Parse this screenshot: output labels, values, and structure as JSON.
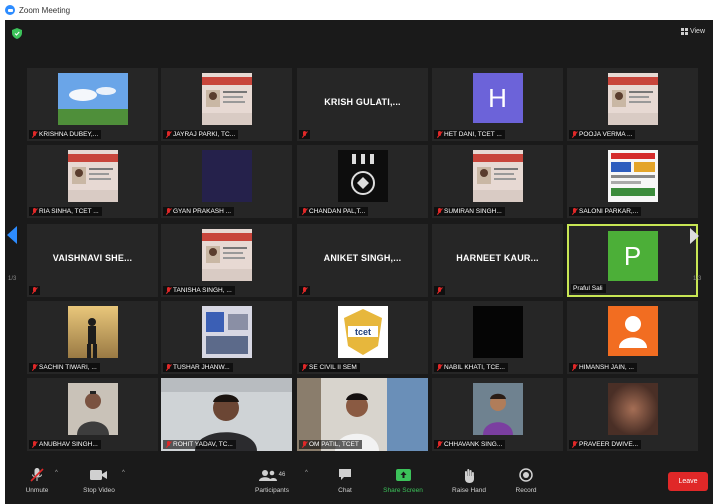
{
  "window": {
    "title": "Zoom Meeting"
  },
  "topbar": {
    "view_label": "View"
  },
  "page_indicator": {
    "left": "1/3",
    "right": "1/3"
  },
  "participants": [
    {
      "name": "KRISHNA DUBEY,...",
      "muted": true,
      "kind": "photo",
      "photo": "sky"
    },
    {
      "name": "JAYRAJ PARKI, TC...",
      "muted": true,
      "kind": "photo",
      "photo": "idcard"
    },
    {
      "name": "",
      "display_text": "KRISH GULATI,...",
      "muted": true,
      "kind": "text"
    },
    {
      "name": "HET DANI, TCET ...",
      "muted": true,
      "kind": "avatar",
      "initial": "H",
      "color": "#6c63d9"
    },
    {
      "name": "POOJA VERMA ...",
      "muted": true,
      "kind": "photo",
      "photo": "idcard"
    },
    {
      "name": "RIA SINHA, TCET ...",
      "muted": true,
      "kind": "photo",
      "photo": "idcard"
    },
    {
      "name": "GYAN PRAKASH ...",
      "muted": true,
      "kind": "photo",
      "photo": "dark"
    },
    {
      "name": "CHANDAN PAL,T...",
      "muted": true,
      "kind": "photo",
      "photo": "crest"
    },
    {
      "name": "SUMIRAN SINGH...",
      "muted": true,
      "kind": "photo",
      "photo": "idcard"
    },
    {
      "name": "SALONI PARKAR,...",
      "muted": true,
      "kind": "photo",
      "photo": "certificate"
    },
    {
      "name": "",
      "display_text": "VAISHNAVI SHE...",
      "muted": true,
      "kind": "text"
    },
    {
      "name": "TANISHA SINGH, ...",
      "muted": true,
      "kind": "photo",
      "photo": "idcard"
    },
    {
      "name": "",
      "display_text": "ANIKET SINGH,...",
      "muted": true,
      "kind": "text"
    },
    {
      "name": "",
      "display_text": "HARNEET KAUR...",
      "muted": true,
      "kind": "text"
    },
    {
      "name": "Praful Sali",
      "muted": false,
      "kind": "avatar",
      "initial": "P",
      "color": "#4caf38",
      "active": true
    },
    {
      "name": "SACHIN TIWARI, ...",
      "muted": true,
      "kind": "photo",
      "photo": "sunset"
    },
    {
      "name": "TUSHAR JHANW...",
      "muted": true,
      "kind": "photo",
      "photo": "room"
    },
    {
      "name": "SE CIVIL II SEM",
      "muted": true,
      "kind": "photo",
      "photo": "logo",
      "logo_text": "tcet"
    },
    {
      "name": "NABIL KHATI, TCE...",
      "muted": true,
      "kind": "photo",
      "photo": "black"
    },
    {
      "name": "HIMANSH JAIN, ...",
      "muted": true,
      "kind": "avatar",
      "initial": "",
      "color": "#f26d21",
      "person_icon": true
    },
    {
      "name": "ANUBHAV SINGH...",
      "muted": true,
      "kind": "photo",
      "photo": "person"
    },
    {
      "name": "ROHIT YADAV, TC...",
      "muted": true,
      "kind": "photo",
      "photo": "video_man"
    },
    {
      "name": "OM PATIL, TCET",
      "muted": true,
      "kind": "photo",
      "photo": "video_boy"
    },
    {
      "name": "CHHAVANK SING...",
      "muted": true,
      "kind": "photo",
      "photo": "person2"
    },
    {
      "name": "PRAVEER DWIVE...",
      "muted": true,
      "kind": "photo",
      "photo": "blur"
    }
  ],
  "toolbar": {
    "unmute_label": "Unmute",
    "stop_video_label": "Stop Video",
    "participants_label": "Participants",
    "participants_count": "46",
    "chat_label": "Chat",
    "share_label": "Share Screen",
    "raise_hand_label": "Raise Hand",
    "record_label": "Record",
    "leave_label": "Leave"
  },
  "colors": {
    "accent": "#2d8cff",
    "active_border": "#c8e654",
    "leave": "#e02828",
    "share": "#3cc25a"
  }
}
